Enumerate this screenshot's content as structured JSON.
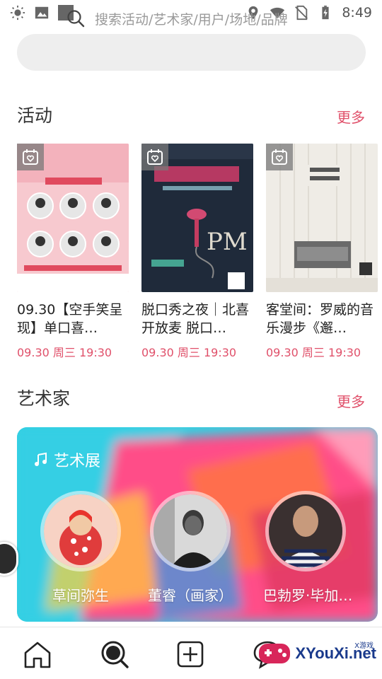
{
  "status_bar": {
    "time": "8:49",
    "left_icons": [
      "brightness-icon",
      "image-icon",
      "square-icon"
    ],
    "right_icons": [
      "location-icon",
      "wifi-icon",
      "no-sim-icon",
      "battery-charging-icon"
    ]
  },
  "search": {
    "placeholder": "搜索活动/艺术家/用户/场地/品牌"
  },
  "events_section": {
    "title": "活动",
    "more": "更多",
    "items": [
      {
        "title": "09.30【空手笑呈现】单口喜…",
        "time": "09.30 周三 19:30"
      },
      {
        "title": "脱口秀之夜｜北喜开放麦 脱口…",
        "time": "09.30 周三 19:30"
      },
      {
        "title": "客堂间：罗威的音乐漫步《邂…",
        "time": "09.30 周三 19:30"
      }
    ]
  },
  "artists_section": {
    "title": "艺术家",
    "more": "更多",
    "banner_label": "艺术展",
    "artists": [
      {
        "name": "草间弥生"
      },
      {
        "name": "董睿（画家）"
      },
      {
        "name": "巴勃罗·毕加…"
      }
    ]
  },
  "bottom_nav": {
    "items": [
      "home-icon",
      "discover-icon",
      "add-icon",
      "message-icon"
    ]
  },
  "watermark": {
    "text": "XYouXi.net",
    "small": "X游戏"
  },
  "colors": {
    "accent": "#e0506a",
    "banner_pink": "#ff3f7e",
    "banner_cyan": "#2fd4e6"
  }
}
